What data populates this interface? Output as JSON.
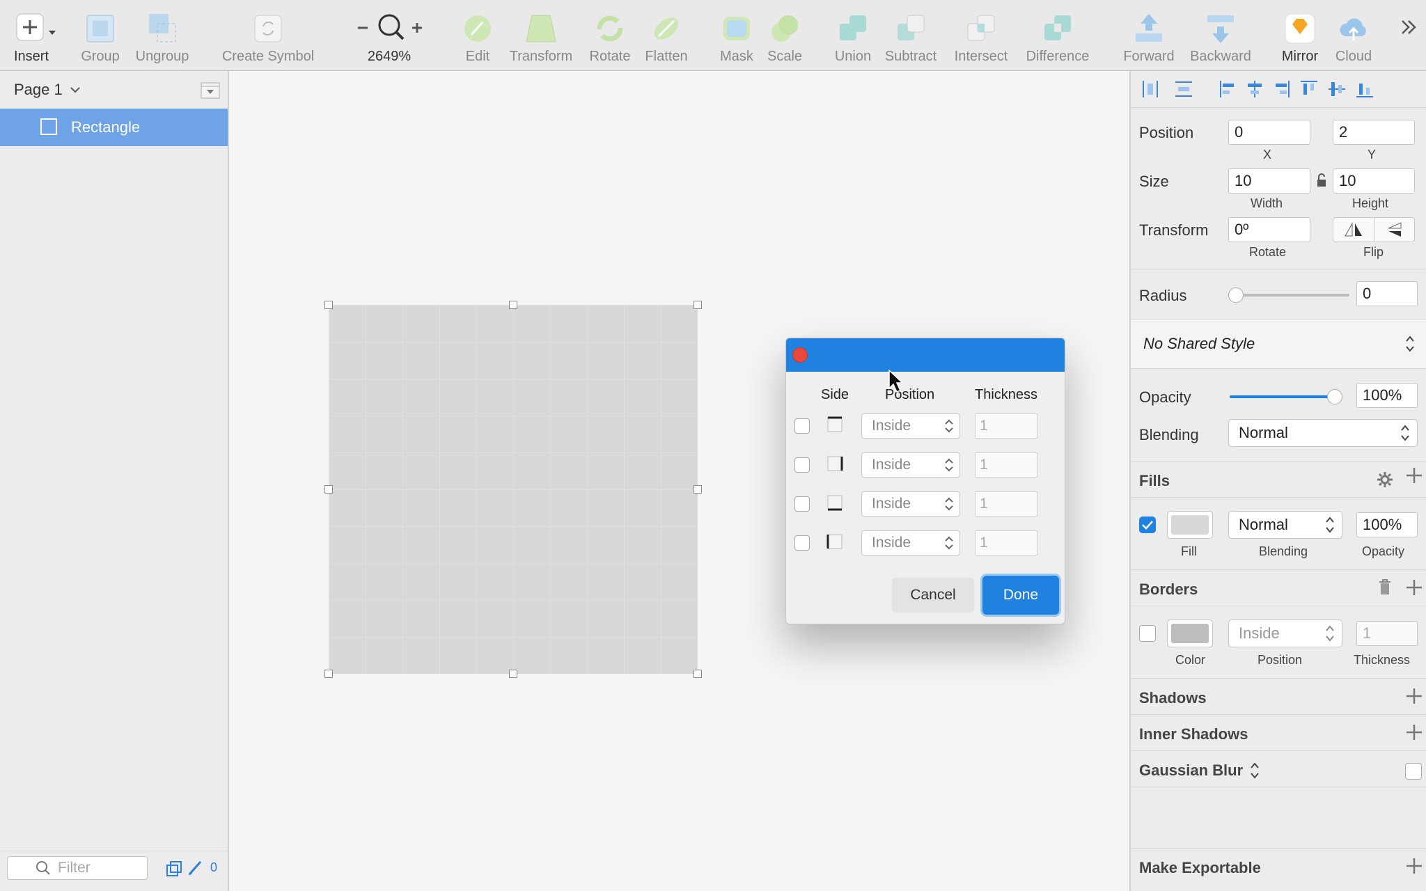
{
  "toolbar": {
    "insert": "Insert",
    "group": "Group",
    "ungroup": "Ungroup",
    "create_symbol": "Create Symbol",
    "zoom_value": "2649%",
    "edit": "Edit",
    "transform": "Transform",
    "rotate": "Rotate",
    "flatten": "Flatten",
    "mask": "Mask",
    "scale": "Scale",
    "union": "Union",
    "subtract": "Subtract",
    "intersect": "Intersect",
    "difference": "Difference",
    "forward": "Forward",
    "backward": "Backward",
    "mirror": "Mirror",
    "cloud": "Cloud"
  },
  "layers": {
    "page_name": "Page 1",
    "items": [
      {
        "name": "Rectangle"
      }
    ],
    "filter_placeholder": "Filter",
    "count": "0"
  },
  "inspector": {
    "position_label": "Position",
    "x_value": "0",
    "x_label": "X",
    "y_value": "2",
    "y_label": "Y",
    "size_label": "Size",
    "width_value": "10",
    "width_label": "Width",
    "height_value": "10",
    "height_label": "Height",
    "transform_label": "Transform",
    "rotate_value": "0º",
    "rotate_label": "Rotate",
    "flip_label": "Flip",
    "radius_label": "Radius",
    "radius_value": "0",
    "shared_style": "No Shared Style",
    "opacity_label": "Opacity",
    "opacity_value": "100%",
    "blending_label": "Blending",
    "blending_value": "Normal",
    "fills_title": "Fills",
    "fill_label": "Fill",
    "fill_blending_value": "Normal",
    "fill_blending_label": "Blending",
    "fill_opacity_value": "100%",
    "fill_opacity_label": "Opacity",
    "borders_title": "Borders",
    "border_color_label": "Color",
    "border_position_value": "Inside",
    "border_position_label": "Position",
    "border_thickness_value": "1",
    "border_thickness_label": "Thickness",
    "shadows_title": "Shadows",
    "inner_shadows_title": "Inner Shadows",
    "gaussian_blur_title": "Gaussian Blur",
    "make_exportable": "Make Exportable"
  },
  "dialog": {
    "col_side": "Side",
    "col_position": "Position",
    "col_thickness": "Thickness",
    "rows": [
      {
        "position": "Inside",
        "thickness": "1"
      },
      {
        "position": "Inside",
        "thickness": "1"
      },
      {
        "position": "Inside",
        "thickness": "1"
      },
      {
        "position": "Inside",
        "thickness": "1"
      }
    ],
    "cancel": "Cancel",
    "done": "Done"
  },
  "colors": {
    "accent": "#1f82e0",
    "selection": "#6ea3e8",
    "close_red": "#e9483c",
    "shape_fill": "#d8d8d8"
  }
}
